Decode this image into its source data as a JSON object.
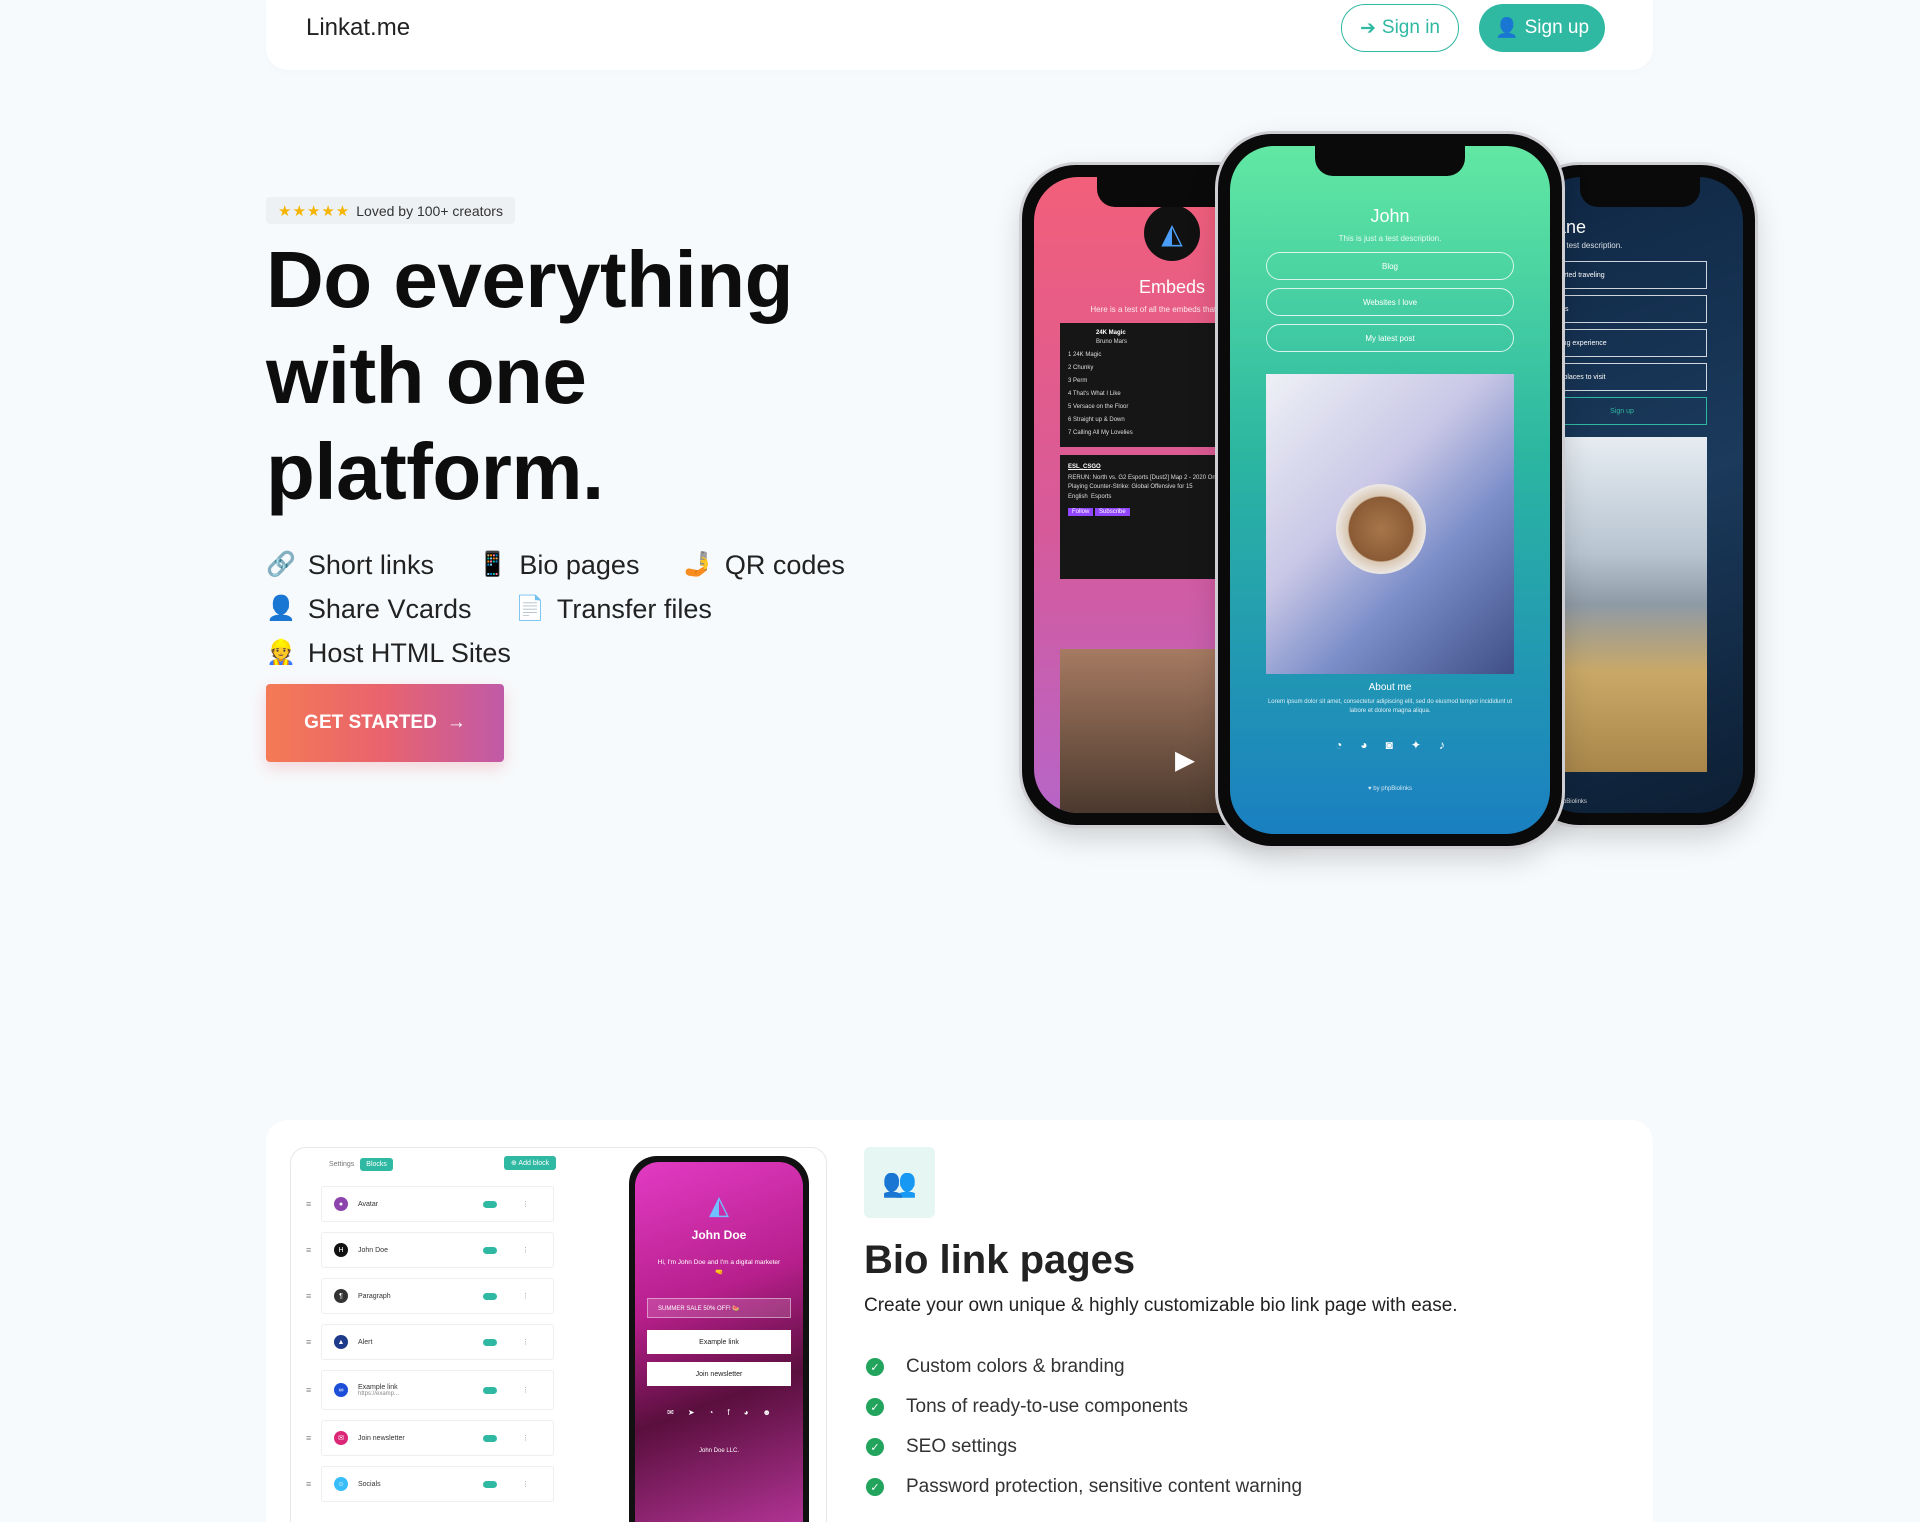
{
  "header": {
    "brand": "Linkat.me",
    "signin_label": "Sign in",
    "signup_label": "Sign up"
  },
  "hero": {
    "badge_stars": "★★★★★",
    "badge_text": "Loved by 100+ creators",
    "title": "Do everything with one platform.",
    "features": [
      {
        "icon": "link-icon",
        "glyph": "🔗",
        "label": "Short links"
      },
      {
        "icon": "phone-icon",
        "glyph": "📱",
        "label": "Bio pages"
      },
      {
        "icon": "qr-icon",
        "glyph": "🤳",
        "label": "QR codes"
      },
      {
        "icon": "user-icon",
        "glyph": "👤",
        "label": "Share Vcards"
      },
      {
        "icon": "file-icon",
        "glyph": "📄",
        "label": "Transfer files"
      },
      {
        "icon": "worker-icon",
        "glyph": "👷",
        "label": "Host HTML Sites"
      }
    ],
    "cta_label": "GET STARTED"
  },
  "phones": {
    "center": {
      "name": "John",
      "desc": "This is just a test description.",
      "links": [
        "Blog",
        "Websites I love",
        "My latest post"
      ],
      "about_title": "About me",
      "about_text": "Lorem ipsum dolor sit amet, consectetur adipiscing elit, sed do eiusmod tempor incididunt ut labore et dolore magna aliqua.",
      "powered": "♥ by phpBiolinks"
    },
    "left": {
      "title": "Embeds",
      "desc": "Here is a test of all the embeds that can be ad",
      "track_title": "24K Magic",
      "track_artist": "Bruno Mars",
      "tracks": [
        "1   24K Magic",
        "2   Chunky",
        "3   Perm",
        "4   That's What I Like",
        "5   Versace on the Floor",
        "6   Straight up & Down",
        "7   Calling All My Lovelies"
      ],
      "stream_channel": "ESL_CSGO",
      "stream_text": "RERUN: North vs. G2 Esports [Dust2] Map 2 - 2020 Online - Group B - EU",
      "stream_playing": "Playing Counter-Strike: Global Offensive for 15",
      "stream_tags": [
        "English",
        "Esports"
      ],
      "follow_label": "Follow",
      "subscribe_label": "Subscribe"
    },
    "right": {
      "name": "Jane",
      "desc": "another test description.",
      "links": [
        "w I started traveling",
        "My trips",
        "traveling experience",
        "op 10 places to visit"
      ],
      "signup_label": "Sign up",
      "powered": "♥ by phpBiolinks"
    }
  },
  "bio_section": {
    "title": "Bio link pages",
    "subtitle": "Create your own unique & highly customizable bio link page with ease.",
    "checks": [
      "Custom colors & branding",
      "Tons of ready-to-use components",
      "SEO settings",
      "Password protection, sensitive content warning"
    ],
    "editor": {
      "tab_settings": "Settings",
      "tab_blocks": "Blocks",
      "add_block": "⊕ Add block",
      "blocks": [
        {
          "label": "Avatar",
          "color": "#8e44ad",
          "glyph": "●"
        },
        {
          "label": "John Doe",
          "color": "#111111",
          "glyph": "H"
        },
        {
          "label": "Paragraph",
          "color": "#333333",
          "glyph": "¶"
        },
        {
          "label": "Alert",
          "color": "#1e3a8a",
          "glyph": "▲"
        },
        {
          "label": "Example link",
          "color": "#1d4ed8",
          "glyph": "∞"
        },
        {
          "label": "Join newsletter",
          "color": "#db2777",
          "glyph": "✉"
        },
        {
          "label": "Socials",
          "color": "#38bdf8",
          "glyph": "☺"
        }
      ],
      "example_link_url": "https://examp...",
      "preview_name": "John Doe",
      "preview_bio": "Hi, I'm John Doe and I'm a digital marketer 🤜",
      "preview_alert": "SUMMER SALE 50% OFF! 🍉",
      "preview_btn1": "Example link",
      "preview_btn2": "Join newsletter",
      "preview_footer": "John Doe LLC."
    }
  },
  "colors": {
    "accent": "#2fb8a2",
    "cta_start": "#f47a55",
    "cta_end": "#c05aa8"
  }
}
